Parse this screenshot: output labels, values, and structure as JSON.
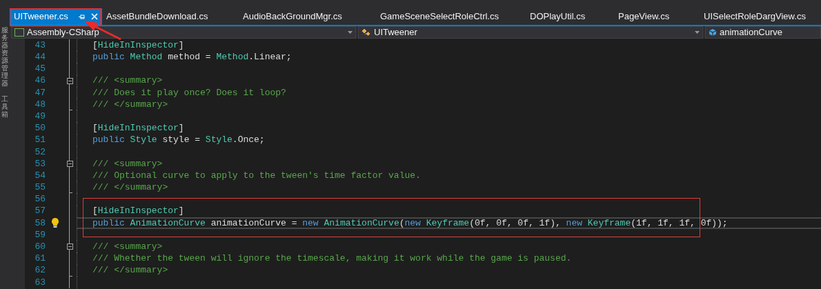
{
  "side_panels": [
    {
      "label": "服务器资源管理器"
    },
    {
      "label": "工具箱"
    }
  ],
  "tabs": [
    {
      "label": "UITweener.cs",
      "selected": true
    },
    {
      "label": "AssetBundleDownload.cs",
      "selected": false
    },
    {
      "label": "AudioBackGroundMgr.cs",
      "selected": false
    },
    {
      "label": "GameSceneSelectRoleCtrl.cs",
      "selected": false
    },
    {
      "label": "DOPlayUtil.cs",
      "selected": false
    },
    {
      "label": "PageView.cs",
      "selected": false
    },
    {
      "label": "UISelectRoleDargView.cs",
      "selected": false
    }
  ],
  "nav_bar": [
    {
      "kind": "project",
      "value": "Assembly-CSharp"
    },
    {
      "kind": "class",
      "value": "UITweener"
    },
    {
      "kind": "member",
      "value": "animationCurve"
    }
  ],
  "code_lines": [
    {
      "number": "43",
      "kind": "line",
      "hint": false,
      "current": false,
      "tokens": [
        {
          "text": "[",
          "kind": "plain"
        },
        {
          "text": "HideInInspector",
          "kind": "type"
        },
        {
          "text": "]",
          "kind": "plain"
        }
      ]
    },
    {
      "number": "44",
      "kind": "line",
      "hint": false,
      "current": false,
      "tokens": [
        {
          "text": "public ",
          "kind": "keyword"
        },
        {
          "text": "Method",
          "kind": "type"
        },
        {
          "text": " method = ",
          "kind": "plain"
        },
        {
          "text": "Method",
          "kind": "type"
        },
        {
          "text": ".Linear;",
          "kind": "plain"
        }
      ]
    },
    {
      "number": "45",
      "kind": "line",
      "hint": false,
      "current": false
    },
    {
      "number": "46",
      "kind": "fold_start",
      "hint": false,
      "current": false,
      "tokens": [
        {
          "text": "/// <summary>",
          "kind": "comment"
        }
      ]
    },
    {
      "number": "47",
      "kind": "line",
      "hint": false,
      "current": false,
      "tokens": [
        {
          "text": "/// Does it play once? Does it loop?",
          "kind": "comment"
        }
      ]
    },
    {
      "number": "48",
      "kind": "fold_end",
      "hint": false,
      "current": false,
      "tokens": [
        {
          "text": "/// </summary>",
          "kind": "comment"
        }
      ]
    },
    {
      "number": "49",
      "kind": "line",
      "hint": false,
      "current": false
    },
    {
      "number": "50",
      "kind": "line",
      "hint": false,
      "current": false,
      "tokens": [
        {
          "text": "[",
          "kind": "plain"
        },
        {
          "text": "HideInInspector",
          "kind": "type"
        },
        {
          "text": "]",
          "kind": "plain"
        }
      ]
    },
    {
      "number": "51",
      "kind": "line",
      "hint": false,
      "current": false,
      "tokens": [
        {
          "text": "public ",
          "kind": "keyword"
        },
        {
          "text": "Style",
          "kind": "type"
        },
        {
          "text": " style = ",
          "kind": "plain"
        },
        {
          "text": "Style",
          "kind": "type"
        },
        {
          "text": ".Once;",
          "kind": "plain"
        }
      ]
    },
    {
      "number": "52",
      "kind": "line",
      "hint": false,
      "current": false
    },
    {
      "number": "53",
      "kind": "fold_start",
      "hint": false,
      "current": false,
      "tokens": [
        {
          "text": "/// <summary>",
          "kind": "comment"
        }
      ]
    },
    {
      "number": "54",
      "kind": "line",
      "hint": false,
      "current": false,
      "tokens": [
        {
          "text": "/// Optional curve to apply to the tween's time factor value.",
          "kind": "comment"
        }
      ]
    },
    {
      "number": "55",
      "kind": "fold_end",
      "hint": false,
      "current": false,
      "tokens": [
        {
          "text": "/// </summary>",
          "kind": "comment"
        }
      ]
    },
    {
      "number": "56",
      "kind": "line",
      "hint": false,
      "current": false
    },
    {
      "number": "57",
      "kind": "line",
      "hint": false,
      "current": false,
      "tokens": [
        {
          "text": "[",
          "kind": "plain"
        },
        {
          "text": "HideInInspector",
          "kind": "type"
        },
        {
          "text": "]",
          "kind": "plain"
        }
      ]
    },
    {
      "number": "58",
      "kind": "line",
      "hint": true,
      "current": true,
      "tokens": [
        {
          "text": "public ",
          "kind": "keyword"
        },
        {
          "text": "AnimationCurve",
          "kind": "type"
        },
        {
          "text": " animationCurve = ",
          "kind": "plain"
        },
        {
          "text": "new ",
          "kind": "keyword"
        },
        {
          "text": "AnimationCurve",
          "kind": "type"
        },
        {
          "text": "(",
          "kind": "plain"
        },
        {
          "text": "new ",
          "kind": "keyword"
        },
        {
          "text": "Keyframe",
          "kind": "type"
        },
        {
          "text": "(0f, 0f, 0f, 1f), ",
          "kind": "plain"
        },
        {
          "text": "new ",
          "kind": "keyword"
        },
        {
          "text": "Keyframe",
          "kind": "type"
        },
        {
          "text": "(1f, 1f, 1f, 0f));",
          "kind": "plain"
        }
      ]
    },
    {
      "number": "59",
      "kind": "line",
      "hint": false,
      "current": false
    },
    {
      "number": "60",
      "kind": "fold_start",
      "hint": false,
      "current": false,
      "tokens": [
        {
          "text": "/// <summary>",
          "kind": "comment"
        }
      ]
    },
    {
      "number": "61",
      "kind": "line",
      "hint": false,
      "current": false,
      "tokens": [
        {
          "text": "/// Whether the tween will ignore the timescale, making it work while the game is paused.",
          "kind": "comment"
        }
      ]
    },
    {
      "number": "62",
      "kind": "fold_end",
      "hint": false,
      "current": false,
      "tokens": [
        {
          "text": "/// </summary>",
          "kind": "comment"
        }
      ]
    },
    {
      "number": "63",
      "kind": "line",
      "hint": false,
      "current": false
    }
  ]
}
